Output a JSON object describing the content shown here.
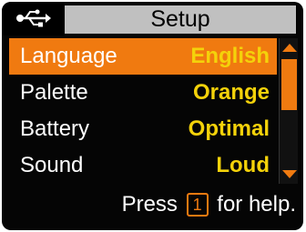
{
  "titlebar": {
    "icon": "usb-icon",
    "title": "Setup"
  },
  "menu": {
    "items": [
      {
        "label": "Language",
        "value": "English",
        "selected": true
      },
      {
        "label": "Palette",
        "value": "Orange",
        "selected": false
      },
      {
        "label": "Battery",
        "value": "Optimal",
        "selected": false
      },
      {
        "label": "Sound",
        "value": "Loud",
        "selected": false
      }
    ]
  },
  "help": {
    "prefix": "Press",
    "key": "1",
    "suffix": "for help."
  },
  "colors": {
    "accent": "#f07a10",
    "value_text": "#f4d20a",
    "background": "#050505",
    "title_bar": "#c0c0c0"
  }
}
